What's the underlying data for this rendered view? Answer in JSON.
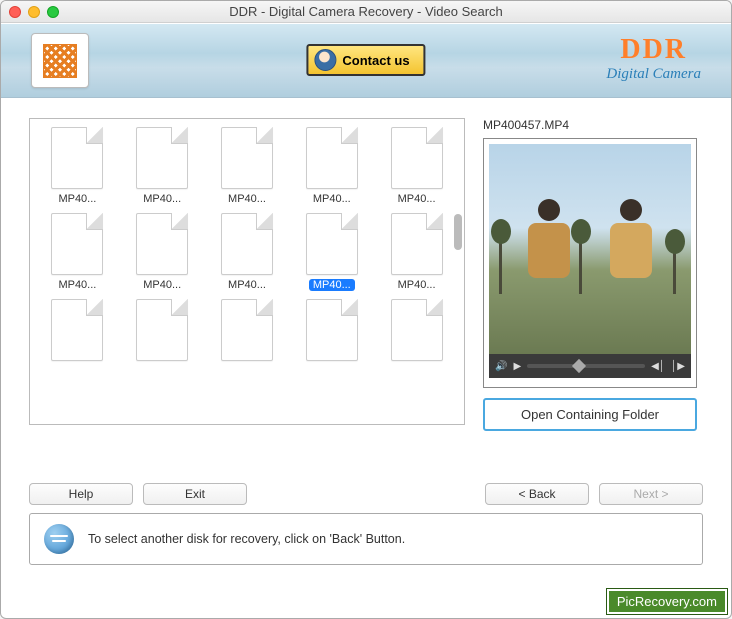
{
  "window": {
    "title": "DDR - Digital Camera Recovery - Video Search"
  },
  "header": {
    "contact_label": "Contact us",
    "brand_name": "DDR",
    "brand_subtitle": "Digital Camera"
  },
  "files": {
    "items": [
      {
        "label": "MP40...",
        "selected": false
      },
      {
        "label": "MP40...",
        "selected": false
      },
      {
        "label": "MP40...",
        "selected": false
      },
      {
        "label": "MP40...",
        "selected": false
      },
      {
        "label": "MP40...",
        "selected": false
      },
      {
        "label": "MP40...",
        "selected": false
      },
      {
        "label": "MP40...",
        "selected": false
      },
      {
        "label": "MP40...",
        "selected": false
      },
      {
        "label": "MP40...",
        "selected": true
      },
      {
        "label": "MP40...",
        "selected": false
      },
      {
        "label": "",
        "selected": false
      },
      {
        "label": "",
        "selected": false
      },
      {
        "label": "",
        "selected": false
      },
      {
        "label": "",
        "selected": false
      },
      {
        "label": "",
        "selected": false
      }
    ]
  },
  "preview": {
    "filename": "MP400457.MP4",
    "open_folder_label": "Open Containing Folder"
  },
  "nav": {
    "help": "Help",
    "exit": "Exit",
    "back": "< Back",
    "next": "Next >"
  },
  "hint": {
    "text": "To select another disk for recovery, click on 'Back' Button."
  },
  "watermark": "PicRecovery.com"
}
